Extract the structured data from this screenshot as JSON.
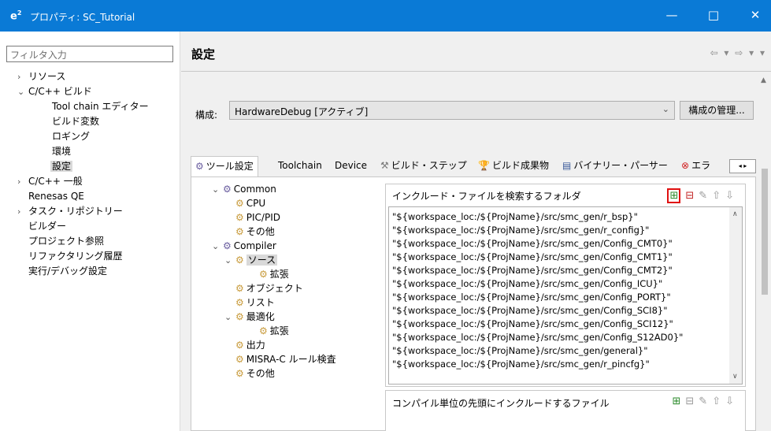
{
  "window": {
    "logo": "e",
    "logo_sup": "2",
    "title": "プロパティ: SC_Tutorial",
    "minimize": "—",
    "maximize": "□",
    "close": "✕"
  },
  "left": {
    "filter_placeholder": "フィルタ入力",
    "items": [
      {
        "label": "リソース",
        "arrow": "›"
      },
      {
        "label": "C/C++ ビルド",
        "arrow": "⌄"
      },
      {
        "label": "Tool chain エディター",
        "arrow": ""
      },
      {
        "label": "ビルド変数",
        "arrow": ""
      },
      {
        "label": "ロギング",
        "arrow": ""
      },
      {
        "label": "環境",
        "arrow": ""
      },
      {
        "label": "設定",
        "arrow": ""
      },
      {
        "label": "C/C++ 一般",
        "arrow": "›"
      },
      {
        "label": "Renesas QE",
        "arrow": ""
      },
      {
        "label": "タスク・リポジトリー",
        "arrow": "›"
      },
      {
        "label": "ビルダー",
        "arrow": ""
      },
      {
        "label": "プロジェクト参照",
        "arrow": ""
      },
      {
        "label": "リファクタリング履歴",
        "arrow": ""
      },
      {
        "label": "実行/デバッグ設定",
        "arrow": ""
      }
    ]
  },
  "header": {
    "title": "設定",
    "nav": "⇦ ▾ ⇨ ▾ ▾"
  },
  "config": {
    "label": "構成:",
    "value": "HardwareDebug [アクティブ]",
    "manage_button": "構成の管理..."
  },
  "tabs": [
    {
      "label": "ツール設定",
      "icon": "⚙"
    },
    {
      "label": "Toolchain",
      "icon": ""
    },
    {
      "label": "Device",
      "icon": ""
    },
    {
      "label": "ビルド・ステップ",
      "icon": "⚒"
    },
    {
      "label": "ビルド成果物",
      "icon": "🏆"
    },
    {
      "label": "バイナリー・パーサー",
      "icon": "▤"
    },
    {
      "label": "エラ",
      "icon": "⊗"
    }
  ],
  "tab_scroll": "◂ ▸",
  "tool_tree": [
    {
      "label": "Common",
      "arrow": "⌄",
      "icon": "gear"
    },
    {
      "label": "CPU",
      "arrow": "",
      "icon": "folder"
    },
    {
      "label": "PIC/PID",
      "arrow": "",
      "icon": "folder"
    },
    {
      "label": "その他",
      "arrow": "",
      "icon": "folder"
    },
    {
      "label": "Compiler",
      "arrow": "⌄",
      "icon": "gear"
    },
    {
      "label": "ソース",
      "arrow": "⌄",
      "icon": "folder"
    },
    {
      "label": "拡張",
      "arrow": "",
      "icon": "folder"
    },
    {
      "label": "オブジェクト",
      "arrow": "",
      "icon": "folder"
    },
    {
      "label": "リスト",
      "arrow": "",
      "icon": "folder"
    },
    {
      "label": "最適化",
      "arrow": "⌄",
      "icon": "folder"
    },
    {
      "label": "拡張",
      "arrow": "",
      "icon": "folder"
    },
    {
      "label": "出力",
      "arrow": "",
      "icon": "folder"
    },
    {
      "label": "MISRA-C ルール検査",
      "arrow": "",
      "icon": "folder"
    },
    {
      "label": "その他",
      "arrow": "",
      "icon": "folder"
    }
  ],
  "include_folders": {
    "heading": "インクルード・ファイルを検索するフォルダ",
    "tools": [
      "add",
      "delete",
      "edit",
      "move-up",
      "move-down"
    ],
    "entries": [
      "\"${workspace_loc:/${ProjName}/src/smc_gen/r_bsp}\"",
      "\"${workspace_loc:/${ProjName}/src/smc_gen/r_config}\"",
      "\"${workspace_loc:/${ProjName}/src/smc_gen/Config_CMT0}\"",
      "\"${workspace_loc:/${ProjName}/src/smc_gen/Config_CMT1}\"",
      "\"${workspace_loc:/${ProjName}/src/smc_gen/Config_CMT2}\"",
      "\"${workspace_loc:/${ProjName}/src/smc_gen/Config_ICU}\"",
      "\"${workspace_loc:/${ProjName}/src/smc_gen/Config_PORT}\"",
      "\"${workspace_loc:/${ProjName}/src/smc_gen/Config_SCI8}\"",
      "\"${workspace_loc:/${ProjName}/src/smc_gen/Config_SCI12}\"",
      "\"${workspace_loc:/${ProjName}/src/smc_gen/Config_S12AD0}\"",
      "\"${workspace_loc:/${ProjName}/src/smc_gen/general}\"",
      "\"${workspace_loc:/${ProjName}/src/smc_gen/r_pincfg}\""
    ]
  },
  "include_files": {
    "heading": "コンパイル単位の先頭にインクルードするファイル"
  }
}
